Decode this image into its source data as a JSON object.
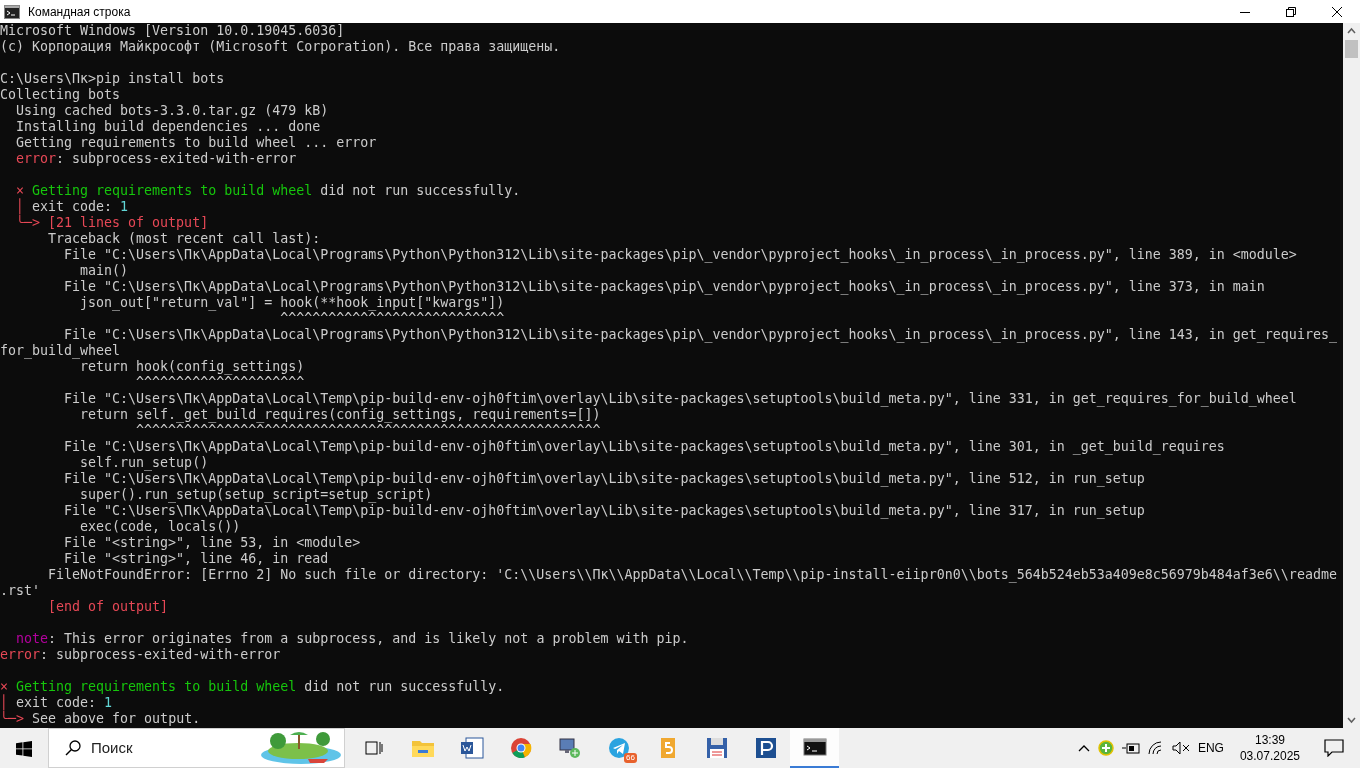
{
  "window": {
    "title": "Командная строка"
  },
  "console": {
    "lines": [
      {
        "kind": "text",
        "segments": [
          {
            "kind": "plain",
            "text": "Microsoft Windows [Version 10.0.19045.6036]"
          }
        ]
      },
      {
        "kind": "text",
        "segments": [
          {
            "kind": "plain",
            "text": "(c) Корпорация Майкрософт (Microsoft Corporation). Все права защищены."
          }
        ]
      },
      {
        "kind": "blank"
      },
      {
        "kind": "text",
        "segments": [
          {
            "kind": "plain",
            "text": "C:\\Users\\Пк>pip install bots"
          }
        ]
      },
      {
        "kind": "text",
        "segments": [
          {
            "kind": "plain",
            "text": "Collecting bots"
          }
        ]
      },
      {
        "kind": "text",
        "segments": [
          {
            "kind": "plain",
            "text": "  Using cached bots-3.3.0.tar.gz (479 kB)"
          }
        ]
      },
      {
        "kind": "text",
        "segments": [
          {
            "kind": "plain",
            "text": "  Installing build dependencies ... done"
          }
        ]
      },
      {
        "kind": "text",
        "segments": [
          {
            "kind": "plain",
            "text": "  Getting requirements to build wheel ... error"
          }
        ]
      },
      {
        "kind": "text",
        "segments": [
          {
            "kind": "error",
            "text": "  error"
          },
          {
            "kind": "plain",
            "text": ": subprocess-exited-with-error"
          }
        ]
      },
      {
        "kind": "blank"
      },
      {
        "kind": "text",
        "segments": [
          {
            "kind": "error",
            "text": "  ×"
          },
          {
            "kind": "success",
            "text": " Getting requirements to build wheel"
          },
          {
            "kind": "plain",
            "text": " did not run successfully."
          }
        ]
      },
      {
        "kind": "text",
        "segments": [
          {
            "kind": "error",
            "text": "  │"
          },
          {
            "kind": "plain",
            "text": " exit code: "
          },
          {
            "kind": "number",
            "text": "1"
          }
        ]
      },
      {
        "kind": "text",
        "segments": [
          {
            "kind": "error",
            "text": "  ╰─> [21 lines of output]"
          }
        ]
      },
      {
        "kind": "text",
        "segments": [
          {
            "kind": "plain",
            "text": "      Traceback (most recent call last):"
          }
        ]
      },
      {
        "kind": "text",
        "segments": [
          {
            "kind": "plain",
            "text": "        File \"C:\\Users\\Пк\\AppData\\Local\\Programs\\Python\\Python312\\Lib\\site-packages\\pip\\_vendor\\pyproject_hooks\\_in_process\\_in_process.py\", line 389, in <module>"
          }
        ]
      },
      {
        "kind": "text",
        "segments": [
          {
            "kind": "plain",
            "text": "          main()"
          }
        ]
      },
      {
        "kind": "text",
        "segments": [
          {
            "kind": "plain",
            "text": "        File \"C:\\Users\\Пк\\AppData\\Local\\Programs\\Python\\Python312\\Lib\\site-packages\\pip\\_vendor\\pyproject_hooks\\_in_process\\_in_process.py\", line 373, in main"
          }
        ]
      },
      {
        "kind": "text",
        "segments": [
          {
            "kind": "plain",
            "text": "          json_out[\"return_val\"] = hook(**hook_input[\"kwargs\"])"
          }
        ]
      },
      {
        "kind": "text",
        "segments": [
          {
            "kind": "plain",
            "text": "                                   ^^^^^^^^^^^^^^^^^^^^^^^^^^^^"
          }
        ]
      },
      {
        "kind": "text",
        "segments": [
          {
            "kind": "plain",
            "text": "        File \"C:\\Users\\Пк\\AppData\\Local\\Programs\\Python\\Python312\\Lib\\site-packages\\pip\\_vendor\\pyproject_hooks\\_in_process\\_in_process.py\", line 143, in get_requires_"
          }
        ]
      },
      {
        "kind": "text",
        "segments": [
          {
            "kind": "plain",
            "text": "for_build_wheel"
          }
        ]
      },
      {
        "kind": "text",
        "segments": [
          {
            "kind": "plain",
            "text": "          return hook(config_settings)"
          }
        ]
      },
      {
        "kind": "text",
        "segments": [
          {
            "kind": "plain",
            "text": "                 ^^^^^^^^^^^^^^^^^^^^^"
          }
        ]
      },
      {
        "kind": "text",
        "segments": [
          {
            "kind": "plain",
            "text": "        File \"C:\\Users\\Пк\\AppData\\Local\\Temp\\pip-build-env-ojh0ftim\\overlay\\Lib\\site-packages\\setuptools\\build_meta.py\", line 331, in get_requires_for_build_wheel"
          }
        ]
      },
      {
        "kind": "text",
        "segments": [
          {
            "kind": "plain",
            "text": "          return self._get_build_requires(config_settings, requirements=[])"
          }
        ]
      },
      {
        "kind": "text",
        "segments": [
          {
            "kind": "plain",
            "text": "                 ^^^^^^^^^^^^^^^^^^^^^^^^^^^^^^^^^^^^^^^^^^^^^^^^^^^^^^^^^^"
          }
        ]
      },
      {
        "kind": "text",
        "segments": [
          {
            "kind": "plain",
            "text": "        File \"C:\\Users\\Пк\\AppData\\Local\\Temp\\pip-build-env-ojh0ftim\\overlay\\Lib\\site-packages\\setuptools\\build_meta.py\", line 301, in _get_build_requires"
          }
        ]
      },
      {
        "kind": "text",
        "segments": [
          {
            "kind": "plain",
            "text": "          self.run_setup()"
          }
        ]
      },
      {
        "kind": "text",
        "segments": [
          {
            "kind": "plain",
            "text": "        File \"C:\\Users\\Пк\\AppData\\Local\\Temp\\pip-build-env-ojh0ftim\\overlay\\Lib\\site-packages\\setuptools\\build_meta.py\", line 512, in run_setup"
          }
        ]
      },
      {
        "kind": "text",
        "segments": [
          {
            "kind": "plain",
            "text": "          super().run_setup(setup_script=setup_script)"
          }
        ]
      },
      {
        "kind": "text",
        "segments": [
          {
            "kind": "plain",
            "text": "        File \"C:\\Users\\Пк\\AppData\\Local\\Temp\\pip-build-env-ojh0ftim\\overlay\\Lib\\site-packages\\setuptools\\build_meta.py\", line 317, in run_setup"
          }
        ]
      },
      {
        "kind": "text",
        "segments": [
          {
            "kind": "plain",
            "text": "          exec(code, locals())"
          }
        ]
      },
      {
        "kind": "text",
        "segments": [
          {
            "kind": "plain",
            "text": "        File \"<string>\", line 53, in <module>"
          }
        ]
      },
      {
        "kind": "text",
        "segments": [
          {
            "kind": "plain",
            "text": "        File \"<string>\", line 46, in read"
          }
        ]
      },
      {
        "kind": "text",
        "segments": [
          {
            "kind": "plain",
            "text": "      FileNotFoundError: [Errno 2] No such file or directory: 'C:\\\\Users\\\\Пк\\\\AppData\\\\Local\\\\Temp\\\\pip-install-eiipr0n0\\\\bots_564b524eb53a409e8c56979b484af3e6\\\\readme"
          }
        ]
      },
      {
        "kind": "text",
        "segments": [
          {
            "kind": "plain",
            "text": ".rst'"
          }
        ]
      },
      {
        "kind": "text",
        "segments": [
          {
            "kind": "error",
            "text": "      [end of output]"
          }
        ]
      },
      {
        "kind": "blank"
      },
      {
        "kind": "text",
        "segments": [
          {
            "kind": "note",
            "text": "  note"
          },
          {
            "kind": "plain",
            "text": ": This error originates from a subprocess, and is likely not a problem with pip."
          }
        ]
      },
      {
        "kind": "text",
        "segments": [
          {
            "kind": "error",
            "text": "error"
          },
          {
            "kind": "plain",
            "text": ": subprocess-exited-with-error"
          }
        ]
      },
      {
        "kind": "blank"
      },
      {
        "kind": "text",
        "segments": [
          {
            "kind": "error",
            "text": "×"
          },
          {
            "kind": "success",
            "text": " Getting requirements to build wheel"
          },
          {
            "kind": "plain",
            "text": " did not run successfully."
          }
        ]
      },
      {
        "kind": "text",
        "segments": [
          {
            "kind": "error",
            "text": "│"
          },
          {
            "kind": "plain",
            "text": " exit code: "
          },
          {
            "kind": "number",
            "text": "1"
          }
        ]
      },
      {
        "kind": "text",
        "segments": [
          {
            "kind": "error",
            "text": "╰─>"
          },
          {
            "kind": "plain",
            "text": " See above for output."
          }
        ]
      }
    ]
  },
  "taskbar": {
    "search": {
      "placeholder": "Поиск"
    },
    "apps": [
      {
        "kind": "explorer",
        "active": false
      },
      {
        "kind": "word",
        "active": false
      },
      {
        "kind": "chrome",
        "active": false
      },
      {
        "kind": "network",
        "active": false
      },
      {
        "kind": "telegram",
        "active": false,
        "badge": "66"
      },
      {
        "kind": "five",
        "active": false
      },
      {
        "kind": "floppy",
        "active": false
      },
      {
        "kind": "pbox",
        "active": false
      },
      {
        "kind": "terminal",
        "active": true
      }
    ],
    "language": "ENG",
    "time": "13:39",
    "date": "03.07.2025"
  }
}
